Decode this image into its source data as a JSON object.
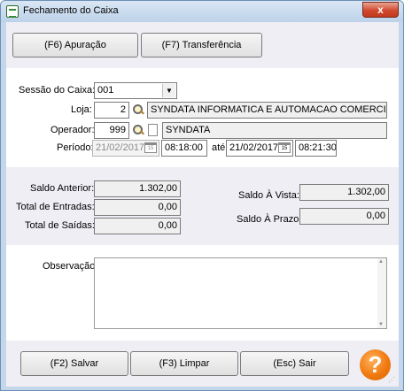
{
  "window": {
    "title": "Fechamento do Caixa",
    "close_glyph": "x"
  },
  "toolbar": {
    "apuracao_label": "(F6) Apuração",
    "transferencia_label": "(F7) Transferência"
  },
  "form": {
    "sessao_label": "Sessão do Caixa:",
    "sessao_value": "001",
    "loja_label": "Loja:",
    "loja_code": "2",
    "loja_name": "SYNDATA INFORMATICA E AUTOMACAO COMERCIAL L",
    "operador_label": "Operador:",
    "operador_code": "999",
    "operador_name": "SYNDATA",
    "periodo_label": "Período:",
    "periodo_date_from": "21/02/2017",
    "periodo_time_from": "08:18:00",
    "ate_label": "até",
    "periodo_date_to": "21/02/2017",
    "periodo_time_to": "08:21:30",
    "calendar_glyph": "15"
  },
  "totals": {
    "saldo_anterior_label": "Saldo Anterior:",
    "saldo_anterior_value": "1.302,00",
    "total_entradas_label": "Total de Entradas:",
    "total_entradas_value": "0,00",
    "total_saidas_label": "Total de Saídas:",
    "total_saidas_value": "0,00",
    "saldo_vista_label": "Saldo À Vista:",
    "saldo_vista_value": "1.302,00",
    "saldo_prazo_label": "Saldo À Prazo:",
    "saldo_prazo_value": "0,00"
  },
  "observacao": {
    "label": "Observação:",
    "value": ""
  },
  "footer": {
    "salvar_label": "(F2) Salvar",
    "limpar_label": "(F3) Limpar",
    "sair_label": "(Esc) Sair",
    "help_glyph": "?"
  },
  "colors": {
    "panel_band": "#f0eef5",
    "help_orange": "#f07a10",
    "close_red": "#d0492f"
  }
}
